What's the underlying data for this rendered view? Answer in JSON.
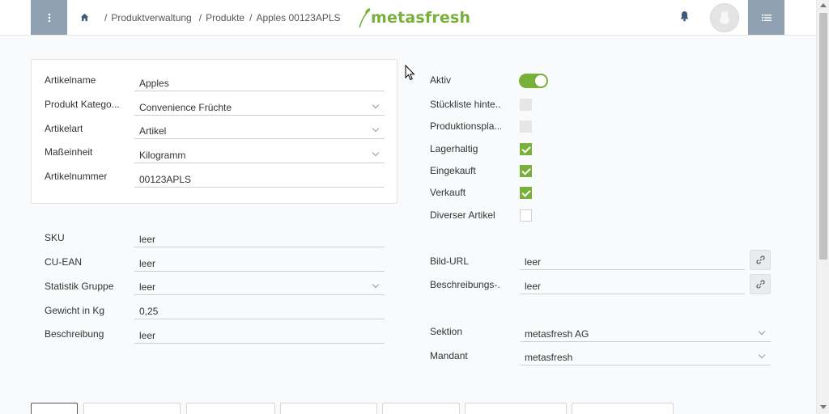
{
  "breadcrumb": {
    "items": [
      "Produktverwaltung",
      "Produkte",
      "Apples 00123APLS"
    ],
    "separator": "/"
  },
  "logo": {
    "text": "metasfresh"
  },
  "colors": {
    "accent": "#78b03a",
    "header_button": "#8fa1b3"
  },
  "card": {
    "fields": [
      {
        "label": "Artikelname",
        "value": "Apples",
        "type": "text"
      },
      {
        "label": "Produkt Katego...",
        "value": "Convenience Früchte",
        "type": "select"
      },
      {
        "label": "Artikelart",
        "value": "Artikel",
        "type": "select"
      },
      {
        "label": "Maßeinheit",
        "value": "Kilogramm",
        "type": "select"
      },
      {
        "label": "Artikelnummer",
        "value": "00123APLS",
        "type": "text"
      }
    ]
  },
  "left_fields": [
    {
      "label": "SKU",
      "value": "leer",
      "type": "text"
    },
    {
      "label": "CU-EAN",
      "value": "leer",
      "type": "text"
    },
    {
      "label": "Statistik Gruppe",
      "value": "leer",
      "type": "select"
    },
    {
      "label": "Gewicht in Kg",
      "value": "0,25",
      "type": "text"
    },
    {
      "label": "Beschreibung",
      "value": "leer",
      "type": "text"
    }
  ],
  "right_flags": [
    {
      "label": "Aktiv",
      "state": "toggle-on"
    },
    {
      "label": "Stückliste hinte...",
      "state": "disabled"
    },
    {
      "label": "Produktionspla...",
      "state": "disabled"
    },
    {
      "label": "Lagerhaltig",
      "state": "checked"
    },
    {
      "label": "Eingekauft",
      "state": "checked"
    },
    {
      "label": "Verkauft",
      "state": "checked"
    },
    {
      "label": "Diverser Artikel",
      "state": "unchecked"
    }
  ],
  "right_fields": [
    {
      "label": "Bild-URL",
      "value": "leer",
      "type": "url"
    },
    {
      "label": "Beschreibungs-...",
      "value": "leer",
      "type": "url"
    },
    {
      "label": "Sektion",
      "value": "metasfresh AG",
      "type": "select"
    },
    {
      "label": "Mandant",
      "value": "metasfresh",
      "type": "select"
    }
  ],
  "icons": {
    "menu": "vertical-dots-icon",
    "home": "home-icon",
    "bell": "bell-icon",
    "sidepanel": "list-icon",
    "link": "link-icon"
  }
}
